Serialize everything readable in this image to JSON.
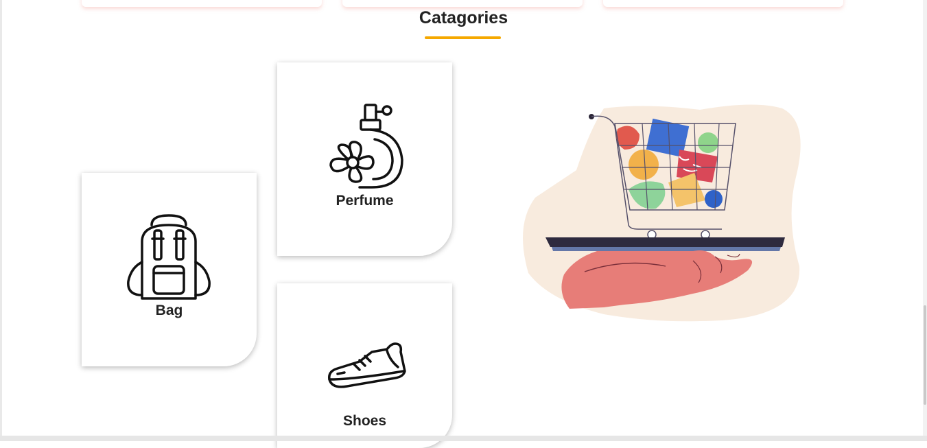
{
  "section": {
    "title": "Catagories",
    "accent_color": "#f5a800"
  },
  "categories": [
    {
      "label": "Bag",
      "icon": "backpack-icon"
    },
    {
      "label": "Perfume",
      "icon": "perfume-icon"
    },
    {
      "label": "Shoes",
      "icon": "sneaker-icon"
    }
  ],
  "illustration": {
    "icon": "shopping-cart-on-hand-illustration"
  }
}
